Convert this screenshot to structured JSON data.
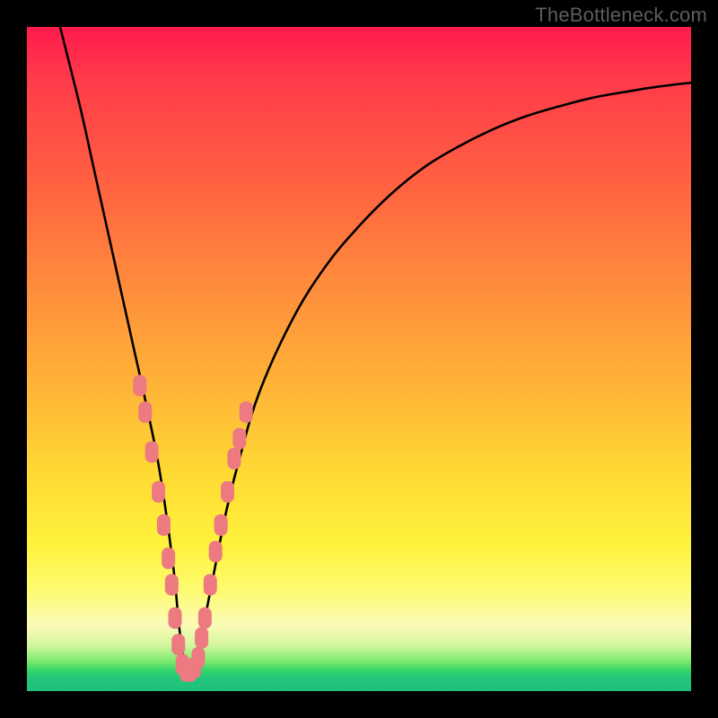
{
  "watermark": "TheBottleneck.com",
  "colors": {
    "frame": "#000000",
    "curve": "#000000",
    "marker_fill": "#ed7a80",
    "marker_stroke": "#db6a70",
    "gradient_top": "#ff1a4d",
    "gradient_bottom": "#20c07a"
  },
  "chart_data": {
    "type": "line",
    "title": "",
    "xlabel": "",
    "ylabel": "",
    "xlim": [
      0,
      100
    ],
    "ylim": [
      0,
      100
    ],
    "note": "Axes are unlabeled; x roughly 0–100 left→right, y is bottleneck % where 0 is the green floor and 100 is the top (red). Values estimated from pixel position. The curve is a V / funnel shape with minimum near x≈24.",
    "series": [
      {
        "name": "bottleneck-curve",
        "x": [
          5,
          8,
          10,
          12,
          14,
          16,
          18,
          20,
          22,
          23,
          24,
          25,
          26,
          28,
          30,
          32,
          35,
          40,
          45,
          50,
          55,
          60,
          65,
          70,
          75,
          80,
          85,
          90,
          95,
          100
        ],
        "y": [
          100,
          88,
          79,
          70,
          61,
          52,
          43,
          33,
          19,
          9,
          3,
          3,
          7,
          17,
          27,
          35,
          45,
          56,
          64,
          70,
          75,
          79,
          82,
          84.5,
          86.5,
          88,
          89.3,
          90.2,
          91,
          91.6
        ]
      }
    ],
    "markers": {
      "name": "highlighted-points",
      "note": "Pink rounded markers clustered along the lower part of the V on both arms and across the trough.",
      "points": [
        {
          "x": 17.0,
          "y": 46
        },
        {
          "x": 17.8,
          "y": 42
        },
        {
          "x": 18.8,
          "y": 36
        },
        {
          "x": 19.8,
          "y": 30
        },
        {
          "x": 20.6,
          "y": 25
        },
        {
          "x": 21.3,
          "y": 20
        },
        {
          "x": 21.8,
          "y": 16
        },
        {
          "x": 22.3,
          "y": 11
        },
        {
          "x": 22.8,
          "y": 7
        },
        {
          "x": 23.4,
          "y": 4
        },
        {
          "x": 24.0,
          "y": 3
        },
        {
          "x": 24.6,
          "y": 3
        },
        {
          "x": 25.2,
          "y": 3.5
        },
        {
          "x": 25.8,
          "y": 5
        },
        {
          "x": 26.3,
          "y": 8
        },
        {
          "x": 26.8,
          "y": 11
        },
        {
          "x": 27.6,
          "y": 16
        },
        {
          "x": 28.4,
          "y": 21
        },
        {
          "x": 29.2,
          "y": 25
        },
        {
          "x": 30.2,
          "y": 30
        },
        {
          "x": 31.2,
          "y": 35
        },
        {
          "x": 32.0,
          "y": 38
        },
        {
          "x": 33.0,
          "y": 42
        }
      ]
    }
  }
}
